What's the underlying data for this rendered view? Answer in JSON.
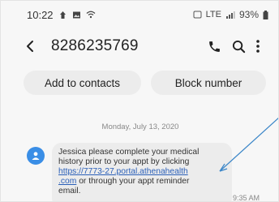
{
  "status_bar": {
    "time": "10:22",
    "network": "LTE",
    "battery": "93%"
  },
  "header": {
    "title": "8286235769",
    "icons": [
      "back-arrow-icon",
      "phone-icon",
      "search-icon",
      "more-vert-icon"
    ]
  },
  "actions": {
    "add_to_contacts": "Add to contacts",
    "block_number": "Block number"
  },
  "conversation": {
    "date": "Monday, July 13, 2020",
    "message": {
      "line1": "Jessica please complete your medical",
      "line2": "history prior to your appt by clicking",
      "link_line1": "https://7773-27.portal.athenahealth",
      "link_line2": ".com",
      "after_link": " or through your appt reminder",
      "line_last": "email.",
      "time": "9:35 AM"
    }
  },
  "colors": {
    "accent": "#3a8ee6",
    "link": "#2a5fb8",
    "bubble": "#ececec"
  }
}
